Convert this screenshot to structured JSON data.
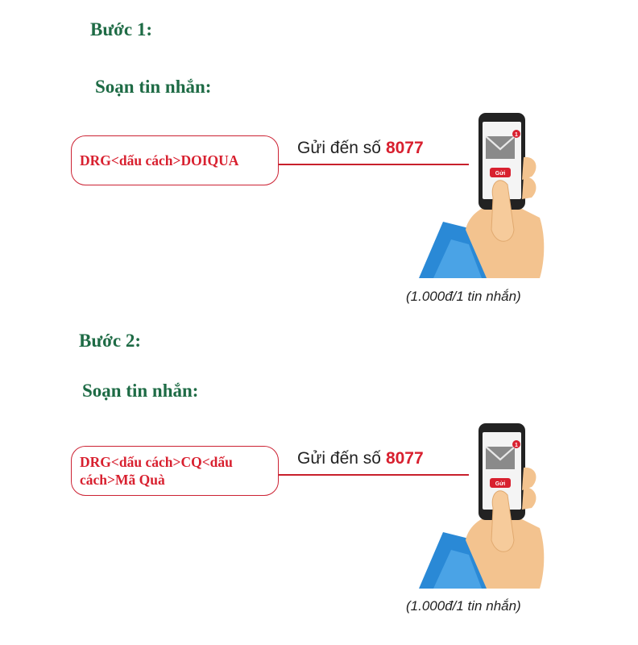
{
  "colors": {
    "heading": "#1e6b45",
    "accent_red": "#d8202f",
    "sleeve_blue": "#2a89d6",
    "skin": "#f3c38f"
  },
  "icons": {
    "phone": "hand-holding-phone-icon",
    "message": "envelope-icon"
  },
  "steps": [
    {
      "title": "Bước 1:",
      "instruction": "Soạn tin nhắn:",
      "message_text": "DRG<dấu cách>DOIQUA",
      "send_to_label": "Gửi đến số",
      "send_to_number": "8077",
      "phone_button_label": "Gửi",
      "notification_badge": "1",
      "price_note": "(1.000đ/1 tin nhắn)"
    },
    {
      "title": "Bước 2:",
      "instruction": "Soạn tin nhắn:",
      "message_text": "DRG<dấu cách>CQ<dấu cách>Mã Quà",
      "send_to_label": "Gửi đến số",
      "send_to_number": "8077",
      "phone_button_label": "Gửi",
      "notification_badge": "1",
      "price_note": "(1.000đ/1 tin nhắn)"
    }
  ]
}
